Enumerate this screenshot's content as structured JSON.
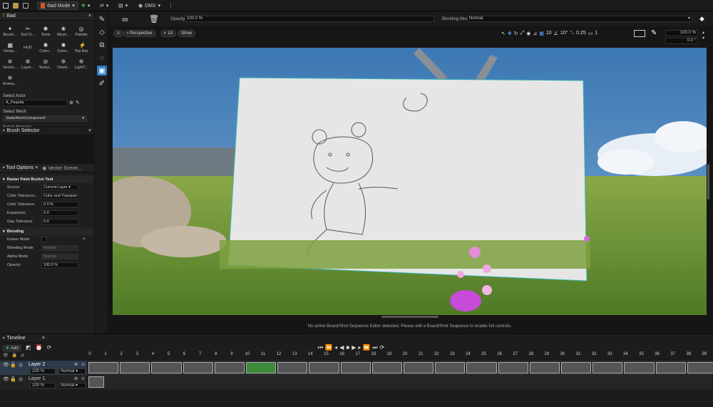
{
  "topbar": {
    "mode_label": "Iliad Mode",
    "dmx_label": "DMX"
  },
  "left_panel": {
    "tab_title": "Iliad",
    "tools": [
      "Brush...",
      "Tool O...",
      "Tools",
      "Mesh...",
      "Palette",
      "Viewp...",
      "HUD",
      "Color...",
      "Color...",
      "Top Bar",
      "Vector...",
      "Layer...",
      "Textur...",
      "Timeli...",
      "LightT...",
      "Anima..."
    ],
    "select_actor_label": "Select Actor",
    "select_actor_value": "A_Paquita",
    "select_mesh_label": "Select Mesh",
    "select_mesh_value": "StaticMeshComponent",
    "select_material_label": "Select Material",
    "brush_selector_tab": "Brush Selector",
    "tool_options_tab": "Tool Options",
    "vector_scene_tab": "Vector Scene...",
    "tool_section_title": "Raster Paint Bucket Tool",
    "props": [
      {
        "label": "Source",
        "value": "Current Layer"
      },
      {
        "label": "Color Tolerance...",
        "value": "Color and Transpar"
      },
      {
        "label": "Color Tolerance",
        "value": "0.0 %"
      },
      {
        "label": "Expansion",
        "value": "0.0"
      },
      {
        "label": "Gap Tolerance",
        "value": "0.0"
      }
    ],
    "blending_section_title": "Blending",
    "blend_props": [
      {
        "label": "Eraser Mode",
        "value": ""
      },
      {
        "label": "Blending Mode",
        "value": "Normal"
      },
      {
        "label": "Alpha Mode",
        "value": "Normal"
      },
      {
        "label": "Opacity",
        "value": "100.0 %"
      }
    ]
  },
  "viewport_top": {
    "opacity_label": "Opacity",
    "opacity_value": "100.0 %",
    "blending_mode_label": "Blending Mode",
    "blending_mode_value": "Normal"
  },
  "viewport_toolbar": {
    "perspective_label": "Perspective",
    "lit_label": "Lit",
    "show_label": "Show",
    "grid_value": "10",
    "angle_value": "10°",
    "scale_value": "0.25",
    "camera_value": "1",
    "zoom_value": "100.0 %",
    "rotation_value": "0.0 °"
  },
  "viewport_status": "No active Board/Shot Sequence Editor detected. Please edit a Board/Shot Sequence to enable full controls.",
  "timeline": {
    "tab_title": "Timeline",
    "add_label": "Add",
    "frames": [
      "0",
      "1",
      "2",
      "3",
      "4",
      "5",
      "6",
      "7",
      "8",
      "9",
      "10",
      "11",
      "12",
      "13",
      "14",
      "15",
      "16",
      "17",
      "18",
      "19",
      "20",
      "21",
      "22",
      "23",
      "24",
      "25",
      "26",
      "27",
      "28",
      "29",
      "30",
      "31",
      "32",
      "33",
      "34",
      "35",
      "36",
      "37",
      "38",
      "39"
    ],
    "current_frame": "7",
    "layers": [
      {
        "name": "Layer 2",
        "opacity": "100 %",
        "blend": "Normal",
        "selected": true
      },
      {
        "name": "Layer 1",
        "opacity": "100 %",
        "blend": "Normal",
        "selected": false
      }
    ]
  },
  "colors": {
    "accent_blue": "#2e80c8",
    "playhead_red": "#8b2a2a",
    "frame_green": "#3a8a3a"
  }
}
